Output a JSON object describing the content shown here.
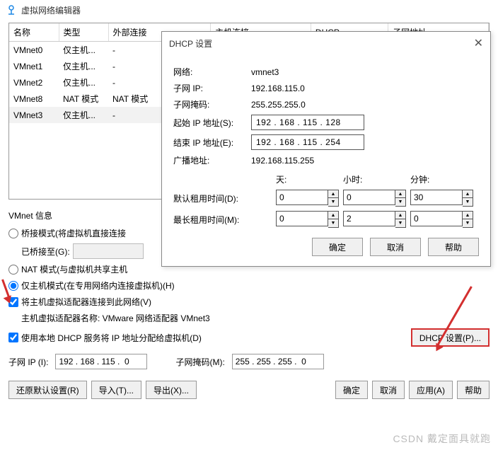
{
  "window": {
    "title": "虚拟网络编辑器"
  },
  "table": {
    "headers": [
      "名称",
      "类型",
      "外部连接",
      "主机连接",
      "DHCP",
      "子网地址"
    ],
    "rows": [
      {
        "name": "VMnet0",
        "type": "仅主机...",
        "ext": "-"
      },
      {
        "name": "VMnet1",
        "type": "仅主机...",
        "ext": "-"
      },
      {
        "name": "VMnet2",
        "type": "仅主机...",
        "ext": "-"
      },
      {
        "name": "VMnet8",
        "type": "NAT 模式",
        "ext": "NAT 模式"
      },
      {
        "name": "VMnet3",
        "type": "仅主机...",
        "ext": "-"
      }
    ]
  },
  "dialog": {
    "title": "DHCP 设置",
    "network_lbl": "网络:",
    "network_val": "vmnet3",
    "subnet_ip_lbl": "子网 IP:",
    "subnet_ip_val": "192.168.115.0",
    "subnet_mask_lbl": "子网掩码:",
    "subnet_mask_val": "255.255.255.0",
    "start_ip_lbl": "起始 IP 地址(S):",
    "start_ip_val": "192 . 168 . 115 . 128",
    "end_ip_lbl": "结束 IP 地址(E):",
    "end_ip_val": "192 . 168 . 115 . 254",
    "broadcast_lbl": "广播地址:",
    "broadcast_val": "192.168.115.255",
    "days_lbl": "天:",
    "hours_lbl": "小时:",
    "minutes_lbl": "分钟:",
    "default_lease_lbl": "默认租用时间(D):",
    "default_lease": {
      "days": "0",
      "hours": "0",
      "minutes": "30"
    },
    "max_lease_lbl": "最长租用时间(M):",
    "max_lease": {
      "days": "0",
      "hours": "2",
      "minutes": "0"
    },
    "ok": "确定",
    "cancel": "取消",
    "help": "帮助"
  },
  "info": {
    "title": "VMnet 信息",
    "bridge": "桥接模式(将虚拟机直接连接",
    "bridged_to_lbl": "已桥接至(G):",
    "nat": "NAT 模式(与虚拟机共享主机",
    "hostonly": "仅主机模式(在专用网络内连接虚拟机)(H)",
    "connect_adapter": "将主机虚拟适配器连接到此网络(V)",
    "adapter_name_lbl": "主机虚拟适配器名称: VMware 网络适配器 VMnet3",
    "use_dhcp": "使用本地 DHCP 服务将 IP 地址分配给虚拟机(D)",
    "dhcp_settings_btn": "DHCP 设置(P)...",
    "subnet_ip_lbl": "子网 IP (I):",
    "subnet_ip_val": "192 . 168 . 115 .  0",
    "subnet_mask_lbl": "子网掩码(M):",
    "subnet_mask_val": "255 . 255 . 255 .  0"
  },
  "bottom": {
    "restore": "还原默认设置(R)",
    "import": "导入(T)...",
    "export": "导出(X)...",
    "ok": "确定",
    "cancel": "取消",
    "apply": "应用(A)",
    "help": "帮助"
  },
  "watermark": "CSDN 戴定面具就跑"
}
